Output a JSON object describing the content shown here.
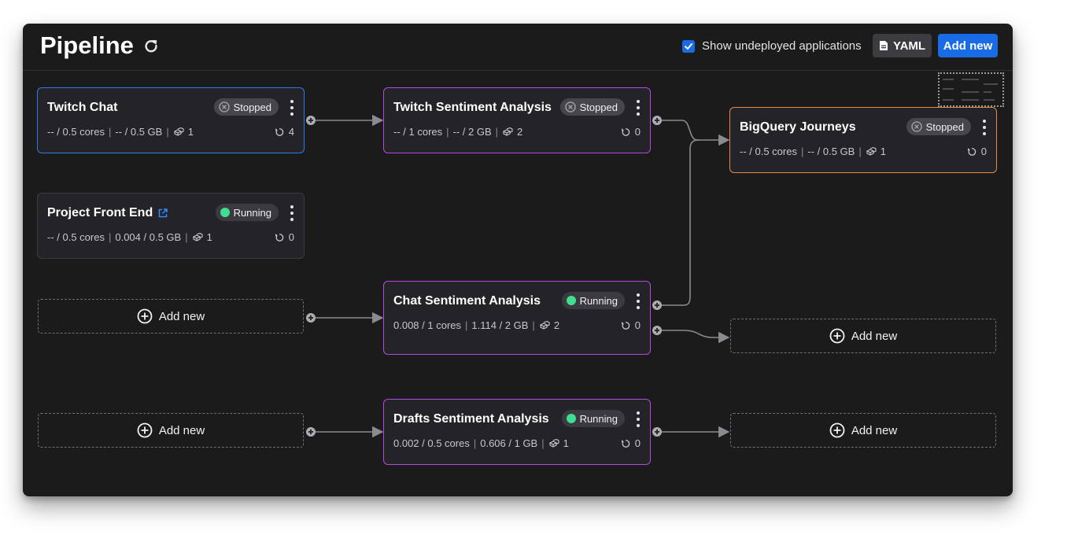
{
  "header": {
    "title": "Pipeline",
    "show_undeployed_label": "Show undeployed applications",
    "show_undeployed_checked": true,
    "yaml_label": "YAML",
    "add_new_label": "Add new"
  },
  "nodes": [
    {
      "name": "Twitch Chat",
      "status": "Stopped",
      "cpu": "-- / 0.5 cores",
      "mem": "-- / 0.5 GB",
      "replicas": "1",
      "restarts": "4",
      "accent": "#2f78ea"
    },
    {
      "name": "Project Front End",
      "status": "Running",
      "cpu": "-- / 0.5 cores",
      "mem": "0.004 / 0.5 GB",
      "replicas": "1",
      "restarts": "0",
      "accent": "#3a3a40",
      "external_link": true
    },
    {
      "name": "Twitch Sentiment Analysis",
      "status": "Stopped",
      "cpu": "-- / 1 cores",
      "mem": "-- / 2 GB",
      "replicas": "2",
      "restarts": "0",
      "accent": "#b04be0"
    },
    {
      "name": "Chat Sentiment Analysis",
      "status": "Running",
      "cpu": "0.008 / 1 cores",
      "mem": "1.114 / 2 GB",
      "replicas": "2",
      "restarts": "0",
      "accent": "#b04be0"
    },
    {
      "name": "Drafts Sentiment Analysis",
      "status": "Running",
      "cpu": "0.002 / 0.5 cores",
      "mem": "0.606 / 1 GB",
      "replicas": "1",
      "restarts": "0",
      "accent": "#b04be0"
    },
    {
      "name": "BigQuery Journeys",
      "status": "Stopped",
      "cpu": "-- / 0.5 cores",
      "mem": "-- / 0.5 GB",
      "replicas": "1",
      "restarts": "0",
      "accent": "#e58a46"
    }
  ],
  "placeholders": [
    {
      "label": "Add new"
    },
    {
      "label": "Add new"
    },
    {
      "label": "Add new"
    },
    {
      "label": "Add new"
    }
  ],
  "colors": {
    "background": "#1b1b1c",
    "card": "#242428",
    "running": "#3ee08f",
    "primary": "#1a6be6",
    "edge": "#8a8a90"
  },
  "icons": [
    "refresh-icon",
    "checkbox-check-icon",
    "document-icon",
    "external-link-icon",
    "stop-icon",
    "kebab-menu-icon",
    "replicas-icon",
    "restart-icon",
    "plus-circle-icon"
  ]
}
